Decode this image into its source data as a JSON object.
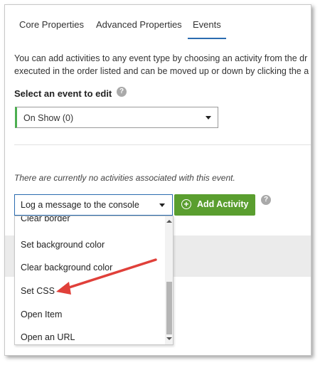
{
  "tabs": {
    "core": "Core Properties",
    "advanced": "Advanced Properties",
    "events": "Events",
    "active": "events"
  },
  "description": {
    "line1": "You can add activities to any event type by choosing an activity from the dr",
    "line2": "executed in the order listed and can be moved up or down by clicking the a"
  },
  "event_section": {
    "label": "Select an event to edit",
    "help_icon": "help-icon",
    "selected_event": "On Show (0)"
  },
  "activities": {
    "empty_message": "There are currently no activities associated with this event.",
    "selected_activity": "Log a message to the console",
    "add_button_label": "Add Activity",
    "options": [
      "Clear border",
      "Set background color",
      "Clear background color",
      "Set CSS",
      "Open Item",
      "Open an URL"
    ]
  },
  "colors": {
    "accent_green": "#5a9e2f",
    "select_border_green": "#4caf50",
    "active_tab_blue": "#2b6cb0",
    "annotation_red": "#e0403a"
  }
}
